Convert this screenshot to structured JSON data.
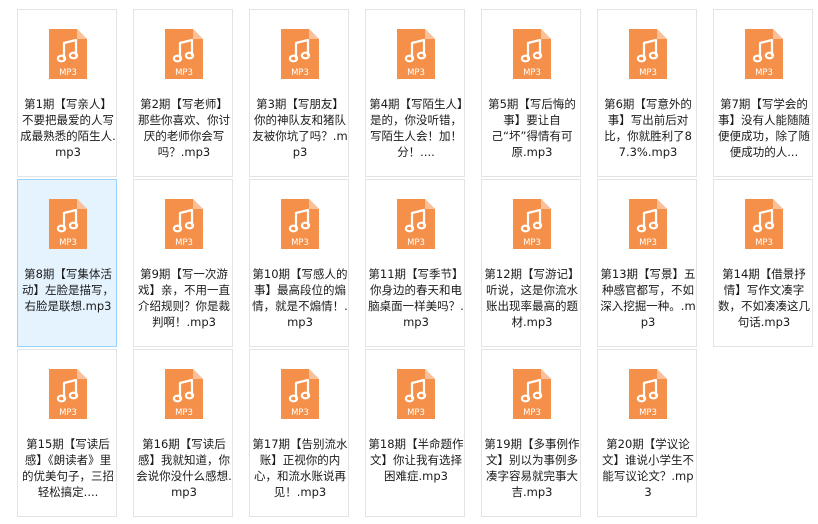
{
  "icon_color": "#f4904a",
  "icon_badge": "MP3",
  "files": [
    {
      "name": "第1期【写亲人】不要把最爱的人写成最熟悉的陌生人.mp3"
    },
    {
      "name": "第2期【写老师】那些你喜欢、你讨厌的老师你会写吗？.mp3"
    },
    {
      "name": "第3期【写朋友】你的神队友和猪队友被你坑了吗？.mp3"
    },
    {
      "name": "第4期【写陌生人】是的，你没听错，写陌生人会！加！分！...."
    },
    {
      "name": "第5期【写后悔的事】要让自己“坏”得情有可原.mp3"
    },
    {
      "name": "第6期【写意外的事】写出前后对比，你就胜利了87.3%.mp3"
    },
    {
      "name": "第7期【写学会的事】没有人能随随便便成功，除了随便成功的人..."
    },
    {
      "name": "第8期【写集体活动】左脸是描写，右脸是联想.mp3"
    },
    {
      "name": "第9期【写一次游戏】亲，不用一直介绍规则？你是裁判啊！.mp3"
    },
    {
      "name": "第10期【写感人的事】最高段位的煽情，就是不煽情！.mp3"
    },
    {
      "name": "第11期【写季节】你身边的春天和电脑桌面一样美吗？.mp3"
    },
    {
      "name": "第12期【写游记】听说，这是你流水账出现率最高的题材.mp3"
    },
    {
      "name": "第13期【写景】五种感官都写，不如深入挖掘一种。.mp3"
    },
    {
      "name": "第14期【借景抒情】写作文凑字数，不如凑凑这几句话.mp3"
    },
    {
      "name": "第15期【写读后感】《朗读者》里的优美句子，三招轻松搞定...."
    },
    {
      "name": "第16期【写读后感】我就知道，你会说你没什么感想.mp3"
    },
    {
      "name": "第17期【告别流水账】正视你的内心，和流水账说再见！.mp3"
    },
    {
      "name": "第18期【半命题作文】你让我有选择困难症.mp3"
    },
    {
      "name": "第19期【多事例作文】别以为事例多凑字容易就完事大吉.mp3"
    },
    {
      "name": "第20期【学议论文】谁说小学生不能写议论文？.mp3"
    }
  ],
  "selected_index": 7
}
